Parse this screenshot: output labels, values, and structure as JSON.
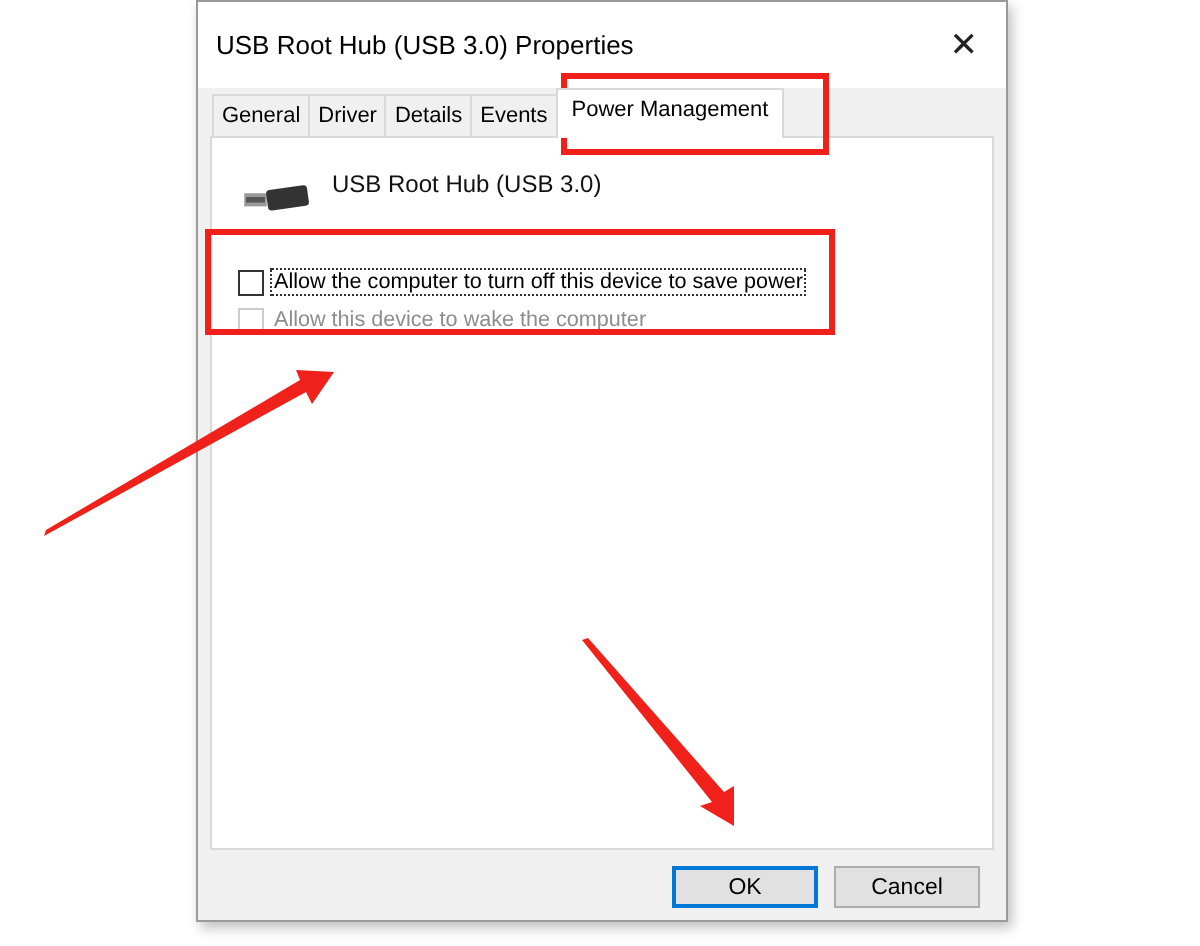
{
  "window": {
    "title": "USB Root Hub (USB 3.0) Properties",
    "close": "✕"
  },
  "tabs": [
    {
      "label": "General",
      "selected": false
    },
    {
      "label": "Driver",
      "selected": false
    },
    {
      "label": "Details",
      "selected": false
    },
    {
      "label": "Events",
      "selected": false
    },
    {
      "label": "Power Management",
      "selected": true
    }
  ],
  "device": {
    "name": "USB Root Hub (USB 3.0)"
  },
  "options": [
    {
      "label": "Allow the computer to turn off this device to save power",
      "checked": false,
      "disabled": false,
      "focused": true
    },
    {
      "label": "Allow this device to wake the computer",
      "checked": false,
      "disabled": true,
      "focused": false
    }
  ],
  "buttons": [
    {
      "label": "OK",
      "default": true
    },
    {
      "label": "Cancel",
      "default": false
    }
  ]
}
